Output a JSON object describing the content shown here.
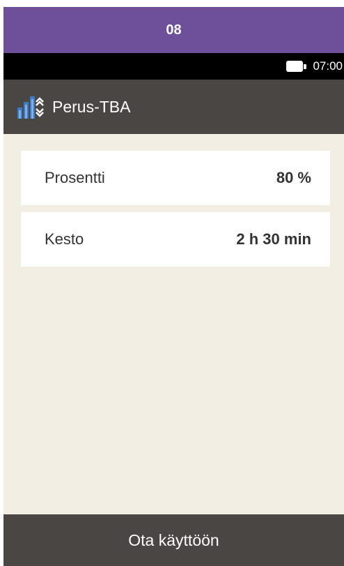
{
  "step_banner": {
    "text": "08"
  },
  "status_bar": {
    "time": "07:00",
    "battery_icon": "battery-full-icon"
  },
  "header": {
    "title": "Perus-TBA",
    "icon": "basal-profile-icon"
  },
  "settings": [
    {
      "label": "Prosentti",
      "value": "80 %"
    },
    {
      "label": "Kesto",
      "value": "2 h 30 min"
    }
  ],
  "footer": {
    "button_label": "Ota käyttöön"
  },
  "colors": {
    "banner": "#6d4f9a",
    "status_bar": "#000000",
    "header": "#4a4643",
    "background": "#f2eee3",
    "card": "#ffffff",
    "icon_blue": "#3d7cc4"
  }
}
